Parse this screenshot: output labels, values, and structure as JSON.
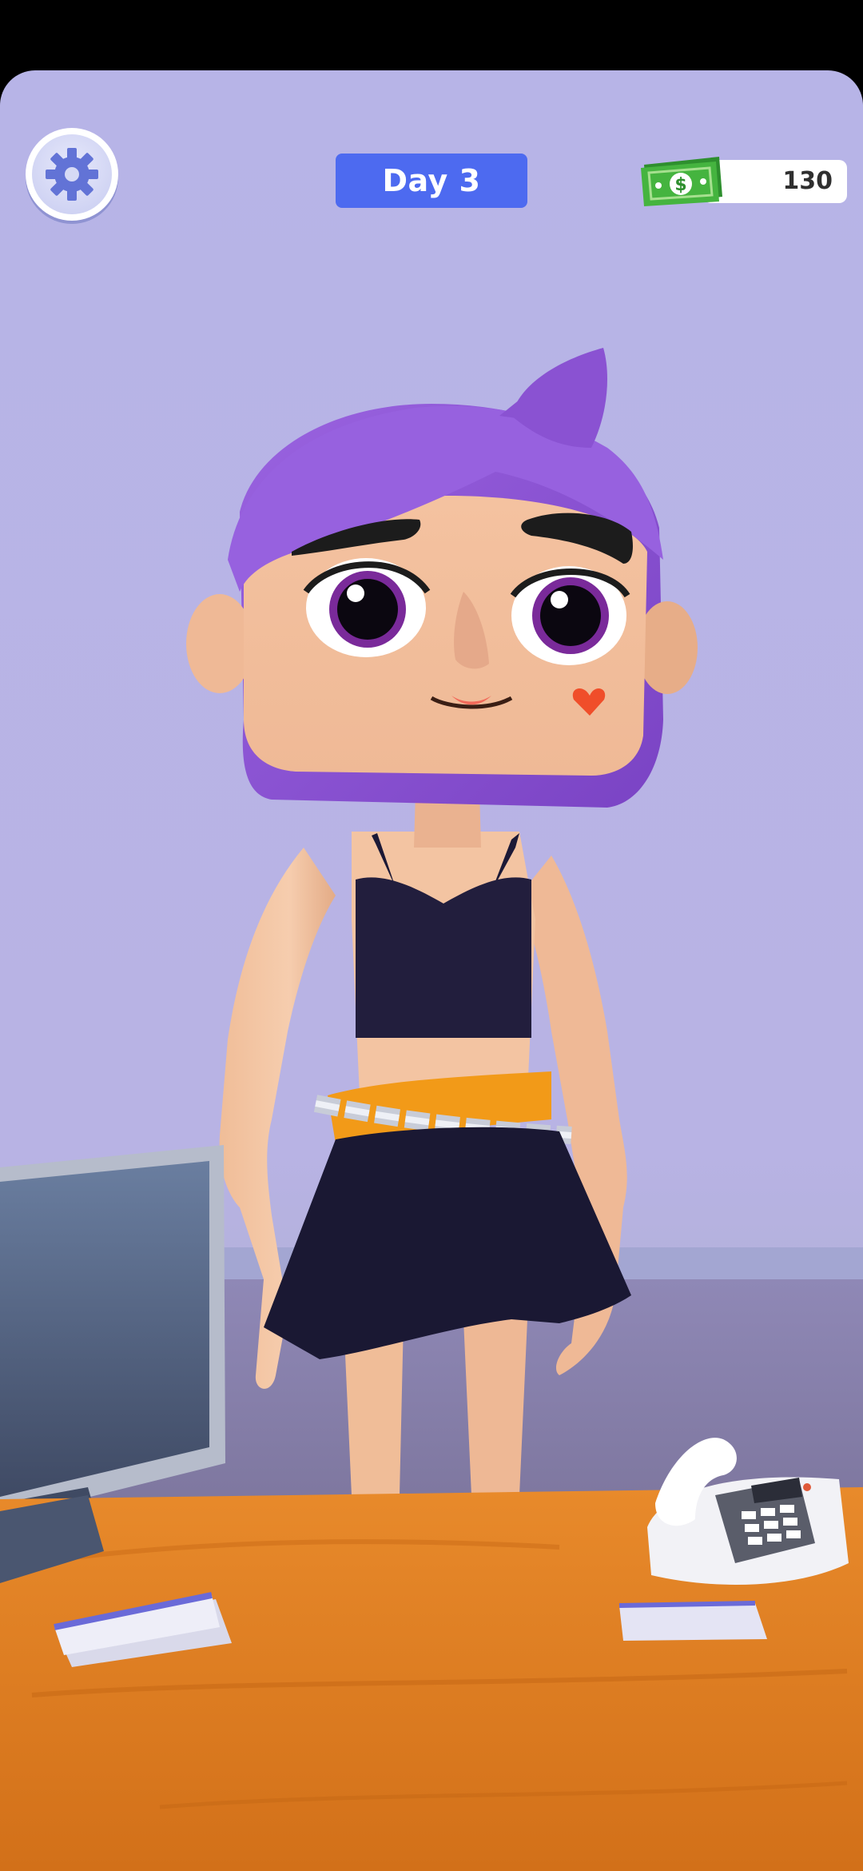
{
  "hud": {
    "settings_icon": "gear-icon",
    "day_label": "Day 3",
    "money_icon": "cash-bill-icon",
    "money_value": "130"
  },
  "colors": {
    "background": "#b7b4e7",
    "day_badge": "#4d6af0",
    "hair": "#8e55d6",
    "outfit": "#1c1936",
    "belt": "#f29a18",
    "desk": "#e07d22",
    "cash": "#3fae3b"
  },
  "scene": {
    "character": "girl-avatar",
    "props": [
      "computer-monitor",
      "desk-phone",
      "desk-papers"
    ]
  }
}
